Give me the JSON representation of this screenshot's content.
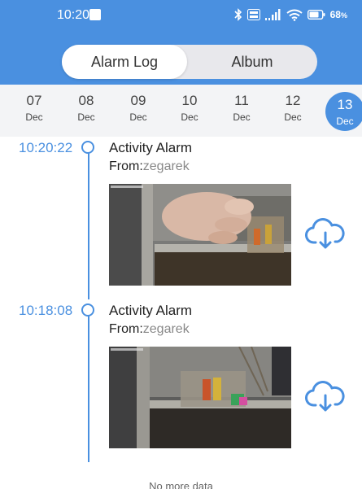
{
  "status": {
    "time": "10:20",
    "battery": "68"
  },
  "tabs": {
    "log": "Alarm Log",
    "album": "Album"
  },
  "dates": [
    {
      "day": "07",
      "month": "Dec"
    },
    {
      "day": "08",
      "month": "Dec"
    },
    {
      "day": "09",
      "month": "Dec"
    },
    {
      "day": "10",
      "month": "Dec"
    },
    {
      "day": "11",
      "month": "Dec"
    },
    {
      "day": "12",
      "month": "Dec"
    },
    {
      "day": "13",
      "month": "Dec"
    }
  ],
  "events": [
    {
      "time": "10:20:22",
      "title": "Activity Alarm",
      "from_label": "From:",
      "source": "zegarek"
    },
    {
      "time": "10:18:08",
      "title": "Activity Alarm",
      "from_label": "From:",
      "source": "zegarek"
    }
  ],
  "footer": {
    "no_more": "No more data"
  },
  "colors": {
    "accent": "#4a90e0"
  },
  "icons": [
    "bluetooth-icon",
    "volte-icon",
    "signal-icon",
    "wifi-icon",
    "battery-icon",
    "cloud-download-icon"
  ]
}
